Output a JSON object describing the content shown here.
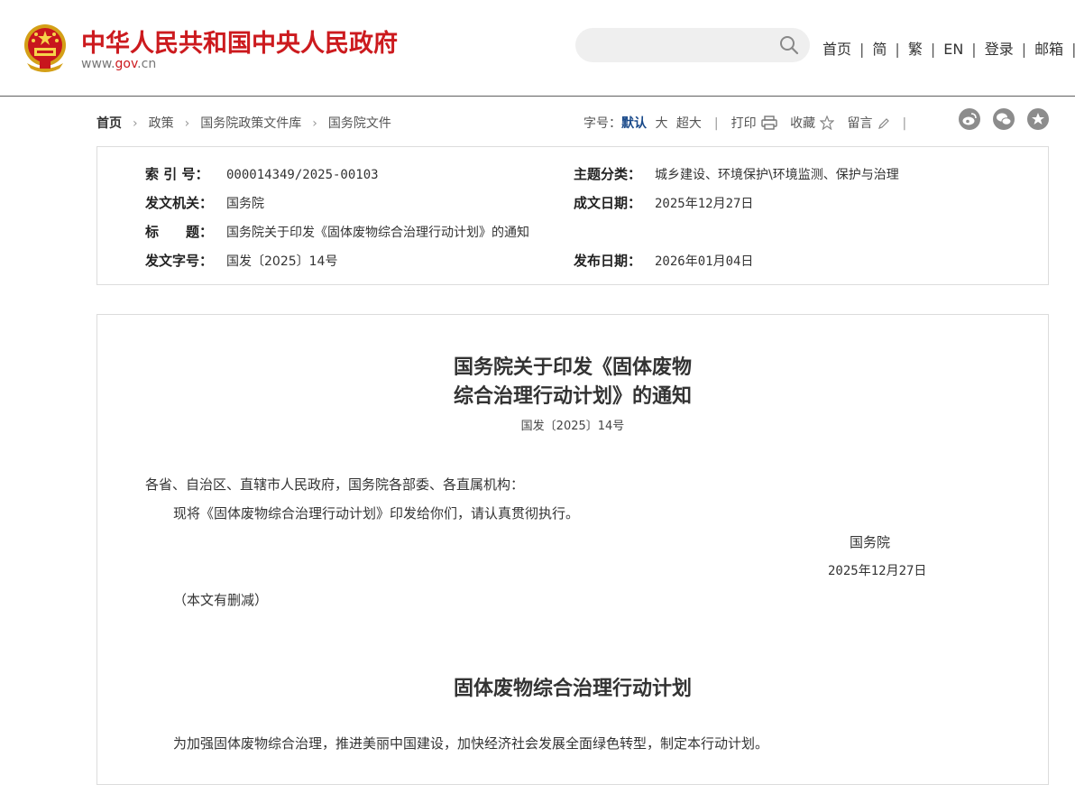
{
  "header": {
    "title": "中华人民共和国中央人民政府",
    "domain_prefix": "www.",
    "domain_brand": "gov",
    "domain_suffix": ".cn",
    "search_placeholder": "",
    "nav": [
      "首页",
      "简",
      "繁",
      "EN",
      "登录",
      "邮箱"
    ]
  },
  "breadcrumb": [
    "首页",
    "政策",
    "国务院政策文件库",
    "国务院文件"
  ],
  "tools": {
    "font_label": "字号：",
    "font_default": "默认",
    "font_large": "大",
    "font_xlarge": "超大",
    "print": "打印",
    "favorite": "收藏",
    "comment": "留言"
  },
  "info": {
    "index_label": "索 引 号：",
    "index_value": "000014349/2025-00103",
    "topic_label": "主题分类：",
    "topic_value": "城乡建设、环境保护\\环境监测、保护与治理",
    "issuer_label": "发文机关：",
    "issuer_value": "国务院",
    "written_label": "成文日期：",
    "written_value": "2025年12月27日",
    "title_label": "标　　题：",
    "title_value": "国务院关于印发《固体废物综合治理行动计划》的通知",
    "docno_label": "发文字号：",
    "docno_value": "国发〔2025〕14号",
    "published_label": "发布日期：",
    "published_value": "2026年01月04日"
  },
  "article": {
    "title_line1": "国务院关于印发《固体废物",
    "title_line2": "综合治理行动计划》的通知",
    "doc_number": "国发〔2025〕14号",
    "salutation": "各省、自治区、直辖市人民政府，国务院各部委、各直属机构：",
    "body": "现将《固体废物综合治理行动计划》印发给你们，请认真贯彻执行。",
    "signature": "国务院",
    "date": "2025年12月27日",
    "note": "（本文有删减）",
    "plan_title": "固体废物综合治理行动计划",
    "plan_intro": "为加强固体废物综合治理，推进美丽中国建设，加快经济社会发展全面绿色转型，制定本行动计划。"
  },
  "colors": {
    "brand_red": "#cc1a1e",
    "link_blue": "#1a4a8a",
    "share_gray": "#8c8c8c"
  }
}
